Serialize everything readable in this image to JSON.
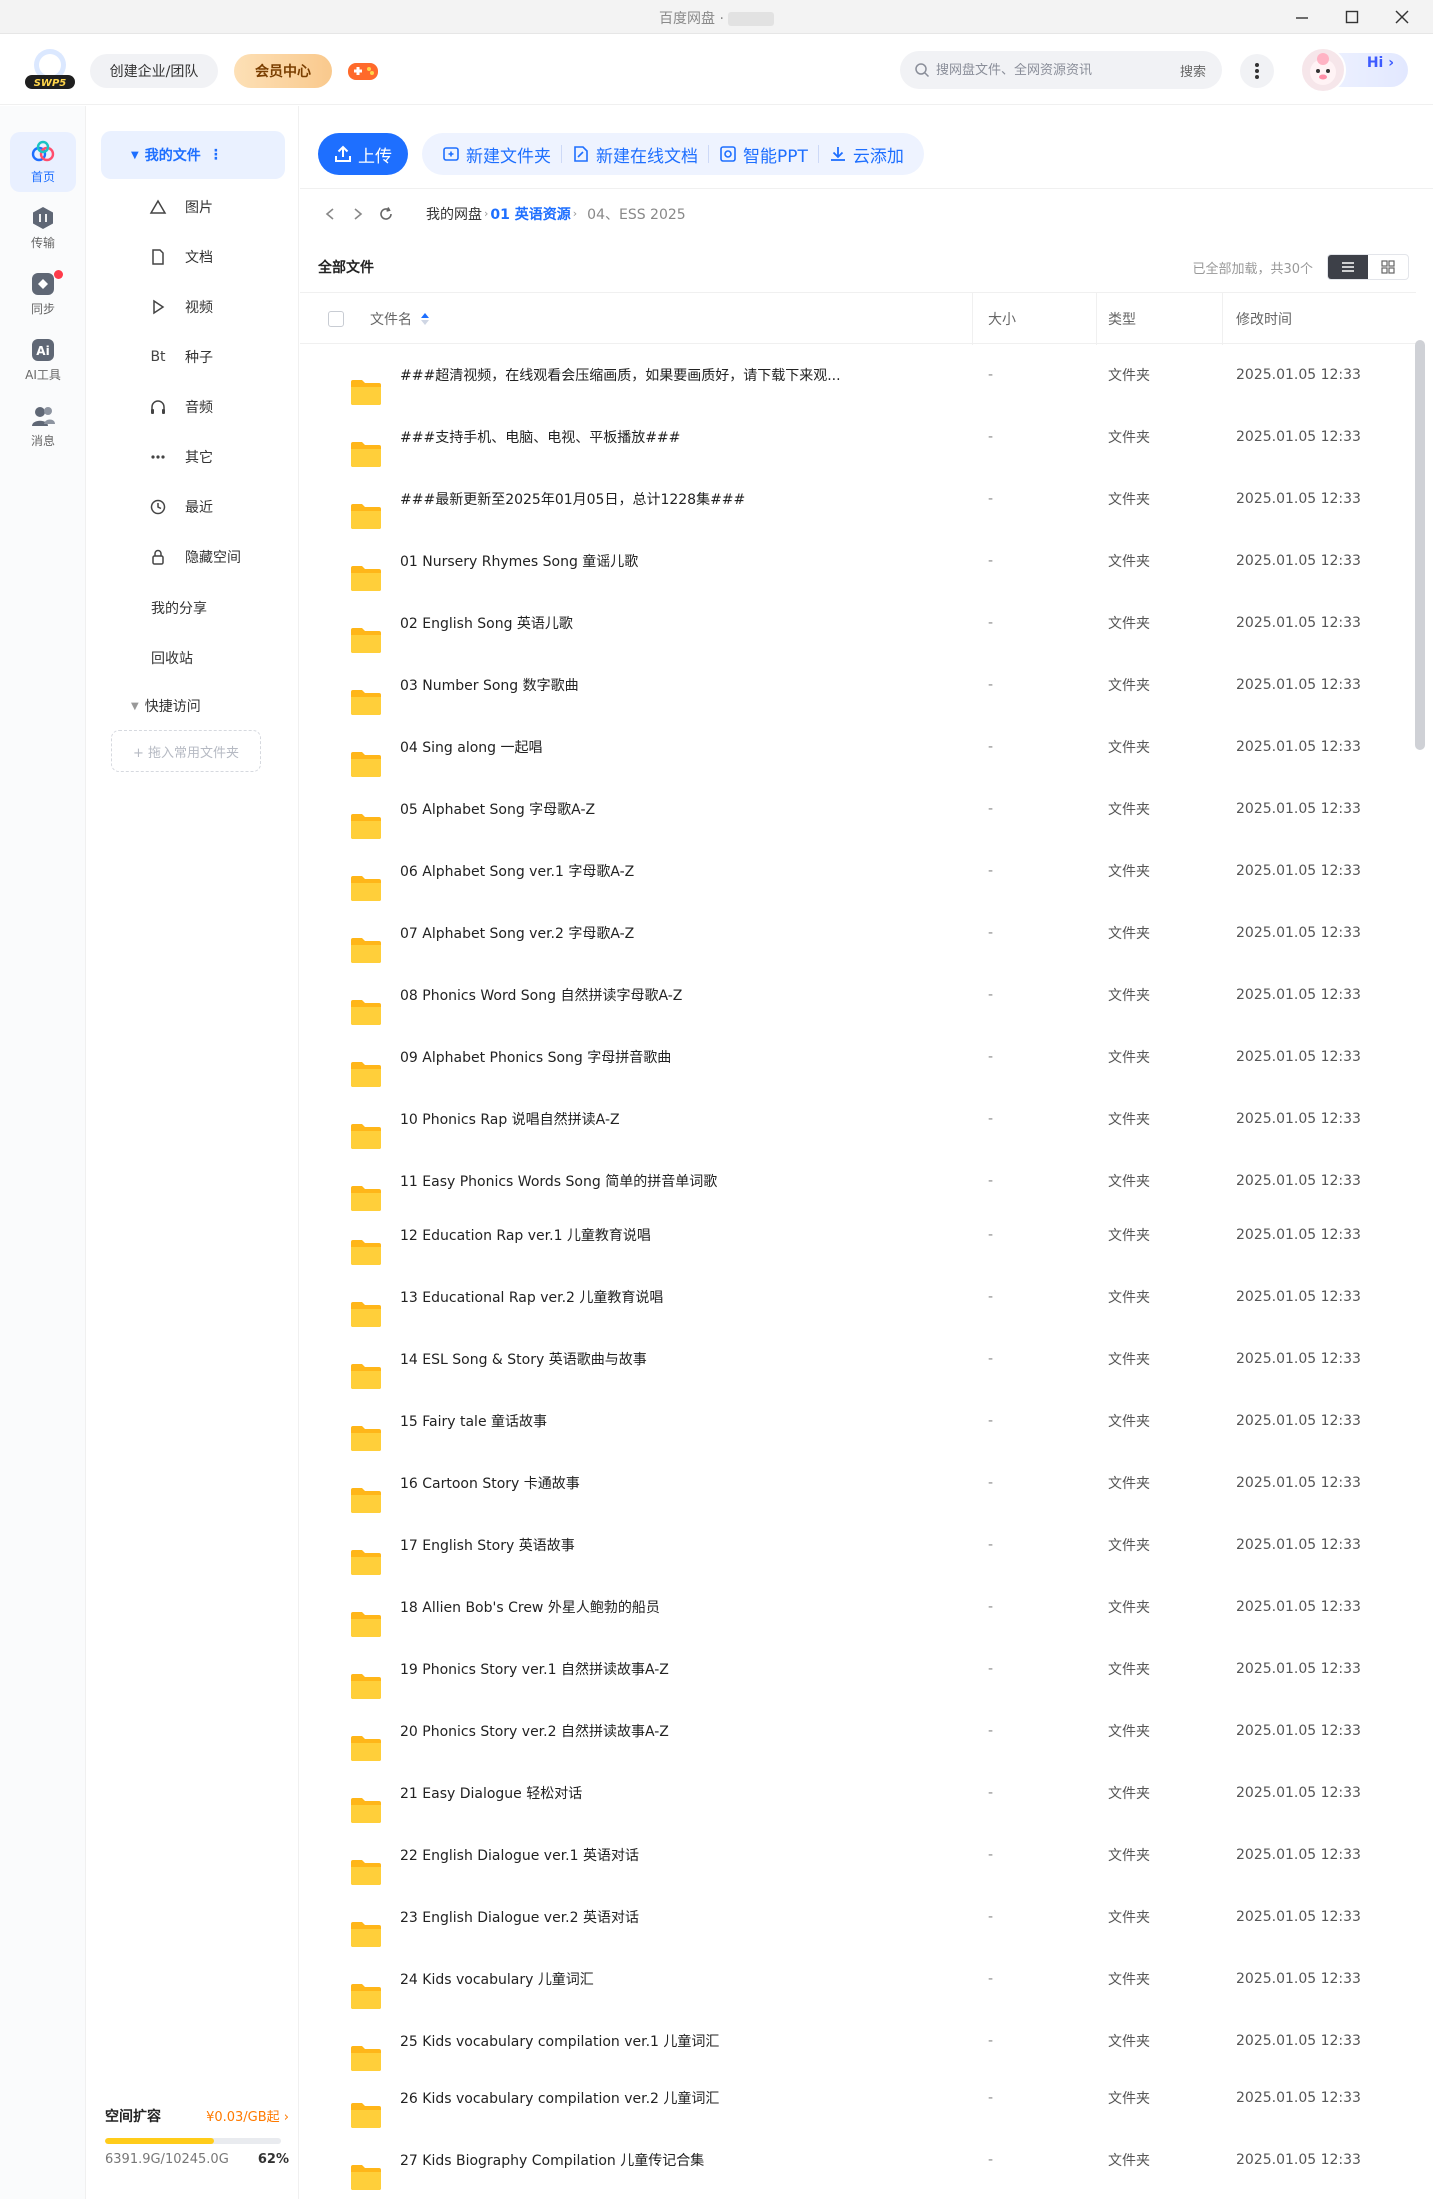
{
  "window": {
    "title": "百度网盘 ·"
  },
  "header": {
    "logo_text": "SWP5",
    "team_btn": "创建企业/团队",
    "vip_btn": "会员中心",
    "search_placeholder": "搜网盘文件、全网资源资讯",
    "search_btn": "搜索",
    "hi_text": "Hi ›"
  },
  "rail": {
    "items": [
      {
        "label": "首页",
        "icon": "home-cloud-icon"
      },
      {
        "label": "传输",
        "icon": "transfer-icon"
      },
      {
        "label": "同步",
        "icon": "sync-icon"
      },
      {
        "label": "AI工具",
        "icon": "ai-icon"
      },
      {
        "label": "消息",
        "icon": "message-icon"
      }
    ]
  },
  "tree": {
    "root": "我的文件",
    "subs": [
      {
        "label": "图片",
        "icon": "image-icon"
      },
      {
        "label": "文档",
        "icon": "document-icon"
      },
      {
        "label": "视频",
        "icon": "video-icon"
      },
      {
        "label": "种子",
        "icon": "torrent-icon",
        "glyph": "Bt"
      },
      {
        "label": "音频",
        "icon": "headphones-icon"
      },
      {
        "label": "其它",
        "icon": "more-dots-icon"
      },
      {
        "label": "最近",
        "icon": "clock-icon"
      },
      {
        "label": "隐藏空间",
        "icon": "lock-icon"
      }
    ],
    "share": "我的分享",
    "recycle": "回收站",
    "quick": "快捷访问",
    "drop": "+ 拖入常用文件夹"
  },
  "storage": {
    "title": "空间扩容",
    "price": "¥0.03/GB起 ›",
    "used": "6391.9G/10245.0G",
    "percent_label": "62%",
    "percent": 62
  },
  "toolbar": {
    "upload": "上传",
    "new_folder": "新建文件夹",
    "new_doc": "新建在线文档",
    "smart_ppt": "智能PPT",
    "cloud_add": "云添加"
  },
  "breadcrumb": {
    "root": "我的网盘",
    "level1": "01 英语资源",
    "level2": "04、ESS 2025"
  },
  "list": {
    "title": "全部文件",
    "count": "已全部加载，共30个",
    "columns": {
      "name": "文件名",
      "size": "大小",
      "type": "类型",
      "time": "修改时间"
    },
    "rows": [
      {
        "name": "###超清视频，在线观看会压缩画质，如果要画质好，请下载下来观...",
        "size": "-",
        "type": "文件夹",
        "time": "2025.01.05 12:33"
      },
      {
        "name": "###支持手机、电脑、电视、平板播放###",
        "size": "-",
        "type": "文件夹",
        "time": "2025.01.05 12:33"
      },
      {
        "name": "###最新更新至2025年01月05日，总计1228集###",
        "size": "-",
        "type": "文件夹",
        "time": "2025.01.05 12:33"
      },
      {
        "name": "01 Nursery Rhymes Song 童谣儿歌",
        "size": "-",
        "type": "文件夹",
        "time": "2025.01.05 12:33"
      },
      {
        "name": "02 English Song 英语儿歌",
        "size": "-",
        "type": "文件夹",
        "time": "2025.01.05 12:33"
      },
      {
        "name": "03 Number Song 数字歌曲",
        "size": "-",
        "type": "文件夹",
        "time": "2025.01.05 12:33"
      },
      {
        "name": "04 Sing along 一起唱",
        "size": "-",
        "type": "文件夹",
        "time": "2025.01.05 12:33"
      },
      {
        "name": "05 Alphabet Song 字母歌A-Z",
        "size": "-",
        "type": "文件夹",
        "time": "2025.01.05 12:33"
      },
      {
        "name": "06 Alphabet Song ver.1 字母歌A-Z",
        "size": "-",
        "type": "文件夹",
        "time": "2025.01.05 12:33"
      },
      {
        "name": "07 Alphabet Song ver.2 字母歌A-Z",
        "size": "-",
        "type": "文件夹",
        "time": "2025.01.05 12:33"
      },
      {
        "name": "08 Phonics Word Song 自然拼读字母歌A-Z",
        "size": "-",
        "type": "文件夹",
        "time": "2025.01.05 12:33"
      },
      {
        "name": "09 Alphabet Phonics Song 字母拼音歌曲",
        "size": "-",
        "type": "文件夹",
        "time": "2025.01.05 12:33"
      },
      {
        "name": "10 Phonics Rap 说唱自然拼读A-Z",
        "size": "-",
        "type": "文件夹",
        "time": "2025.01.05 12:33"
      },
      {
        "name": "11 Easy Phonics Words Song 简单的拼音单词歌",
        "size": "-",
        "type": "文件夹",
        "time": "2025.01.05 12:33"
      },
      {
        "name": "12 Education Rap ver.1 儿童教育说唱",
        "size": "-",
        "type": "文件夹",
        "time": "2025.01.05 12:33"
      },
      {
        "name": "13 Educational Rap ver.2 儿童教育说唱",
        "size": "-",
        "type": "文件夹",
        "time": "2025.01.05 12:33"
      },
      {
        "name": "14 ESL Song & Story 英语歌曲与故事",
        "size": "-",
        "type": "文件夹",
        "time": "2025.01.05 12:33"
      },
      {
        "name": "15 Fairy tale 童话故事",
        "size": "-",
        "type": "文件夹",
        "time": "2025.01.05 12:33"
      },
      {
        "name": "16 Cartoon Story 卡通故事",
        "size": "-",
        "type": "文件夹",
        "time": "2025.01.05 12:33"
      },
      {
        "name": "17 English Story 英语故事",
        "size": "-",
        "type": "文件夹",
        "time": "2025.01.05 12:33"
      },
      {
        "name": "18 Allien Bob's Crew 外星人鲍勃的船员",
        "size": "-",
        "type": "文件夹",
        "time": "2025.01.05 12:33"
      },
      {
        "name": "19 Phonics Story ver.1 自然拼读故事A-Z",
        "size": "-",
        "type": "文件夹",
        "time": "2025.01.05 12:33"
      },
      {
        "name": "20 Phonics Story ver.2 自然拼读故事A-Z",
        "size": "-",
        "type": "文件夹",
        "time": "2025.01.05 12:33"
      },
      {
        "name": "21 Easy Dialogue 轻松对话",
        "size": "-",
        "type": "文件夹",
        "time": "2025.01.05 12:33"
      },
      {
        "name": "22 English Dialogue ver.1 英语对话",
        "size": "-",
        "type": "文件夹",
        "time": "2025.01.05 12:33"
      },
      {
        "name": "23 English Dialogue ver.2 英语对话",
        "size": "-",
        "type": "文件夹",
        "time": "2025.01.05 12:33"
      },
      {
        "name": "24 Kids vocabulary 儿童词汇",
        "size": "-",
        "type": "文件夹",
        "time": "2025.01.05 12:33"
      },
      {
        "name": "25 Kids vocabulary compilation ver.1 儿童词汇",
        "size": "-",
        "type": "文件夹",
        "time": "2025.01.05 12:33"
      },
      {
        "name": "26 Kids vocabulary compilation ver.2 儿童词汇",
        "size": "-",
        "type": "文件夹",
        "time": "2025.01.05 12:33"
      },
      {
        "name": "27 Kids Biography Compilation 儿童传记合集",
        "size": "-",
        "type": "文件夹",
        "time": "2025.01.05 12:33"
      }
    ]
  },
  "colors": {
    "accent": "#1e6fff",
    "folder": "#ffc933",
    "vip": "#f9c98d",
    "badge": "#ff3b4a"
  }
}
